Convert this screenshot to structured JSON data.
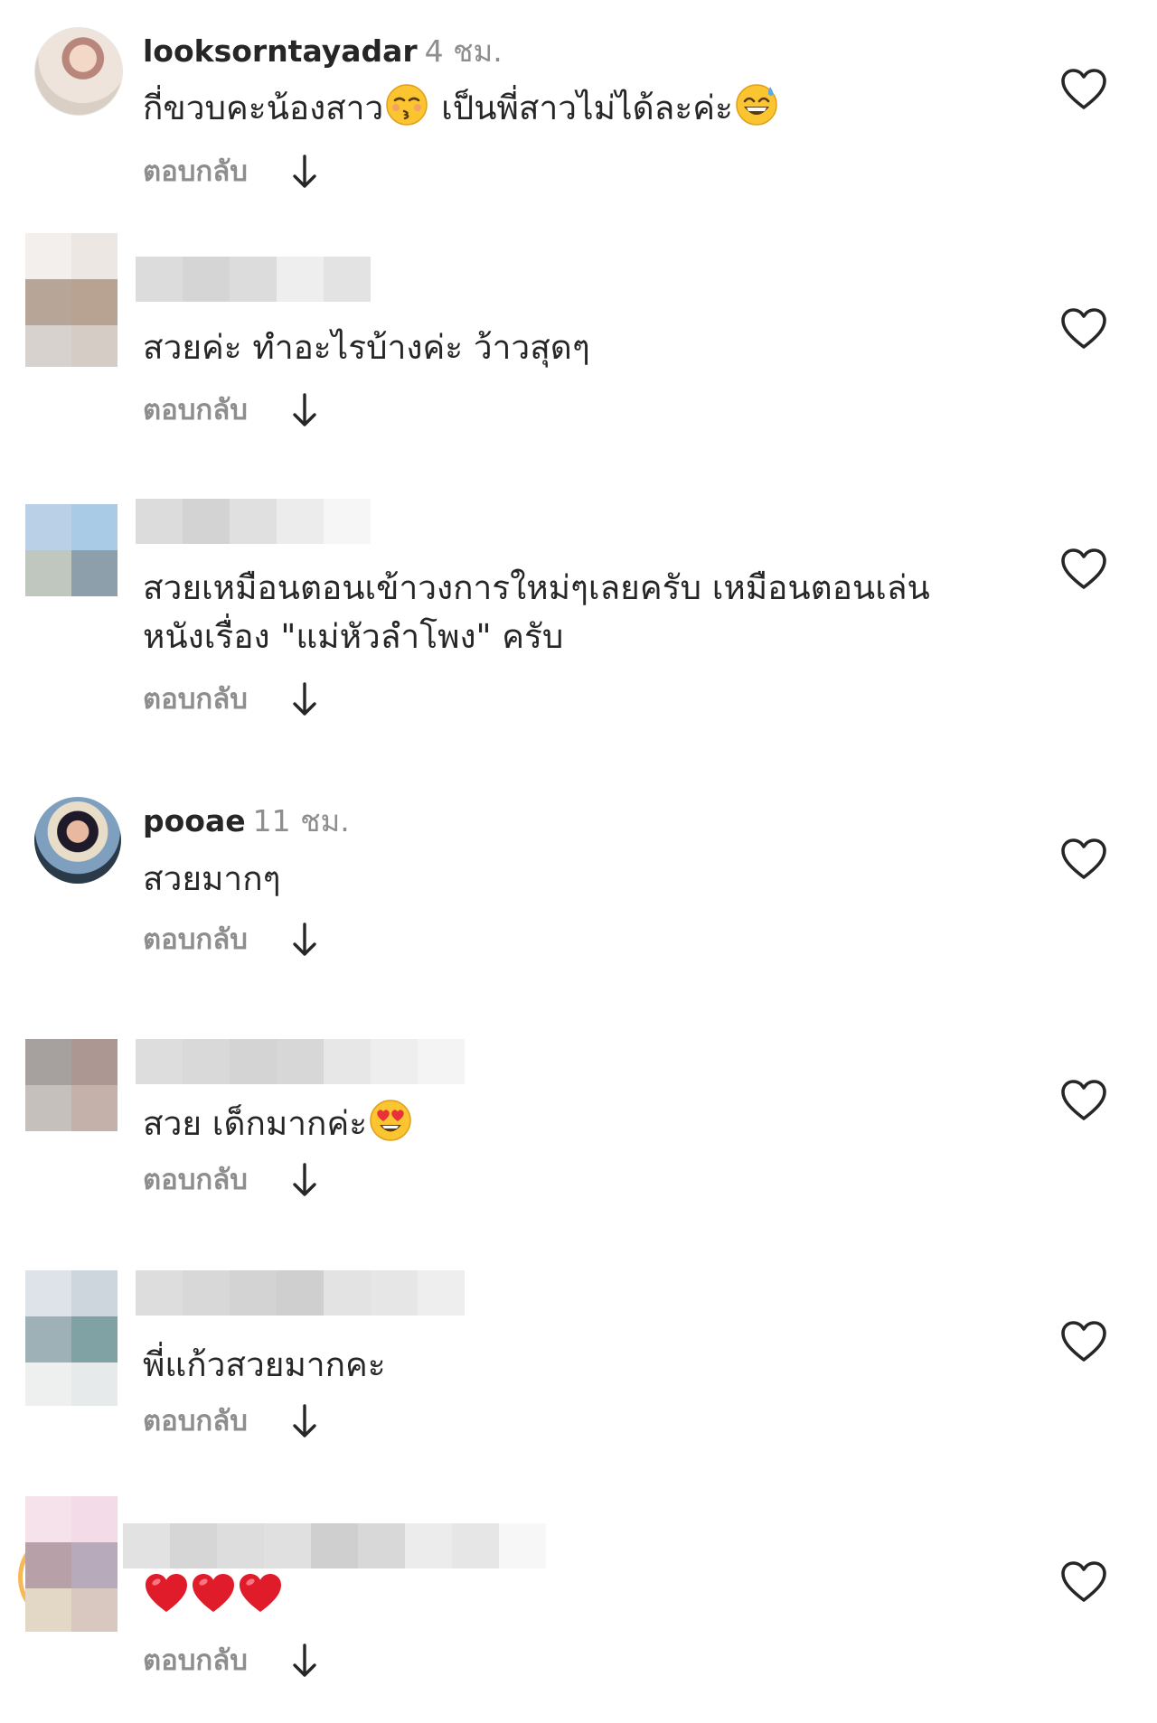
{
  "comments": [
    {
      "username": "looksorntayadar",
      "time": "4 ชม.",
      "text_before": "กี่ขวบคะน้องสาว",
      "emoji_1": "kissing-closed-eyes-emoji",
      "text_middle": "เป็นพี่สาวไม่ได้ละค่ะ",
      "emoji_2": "grinning-sweat-emoji",
      "reply_label": "ตอบกลับ"
    },
    {
      "text": "สวยค่ะ ทำอะไรบ้างค่ะ ว้าวสุดๆ",
      "reply_label": "ตอบกลับ"
    },
    {
      "text_line1": "สวยเหมือนตอนเข้าวงการใหม่ๆเลยครับ เหมือนตอนเล่น",
      "text_line2": "หนังเรื่อง \"แม่หัวลำโพง\" ครับ",
      "reply_label": "ตอบกลับ"
    },
    {
      "username": "pooae",
      "time": "11 ชม.",
      "text": "สวยมากๆ",
      "reply_label": "ตอบกลับ"
    },
    {
      "text": "สวย เด็กมากค่ะ",
      "emoji": "heart-eyes-emoji",
      "reply_label": "ตอบกลับ"
    },
    {
      "text": "พี่แก้วสวยมากคะ",
      "reply_label": "ตอบกลับ"
    },
    {
      "text": "",
      "emoji": "red-heart-emoji",
      "emoji_count": 3,
      "reply_label": "ตอบกลับ"
    }
  ],
  "colors": {
    "text": "#262626",
    "secondary": "#8e8e8e",
    "story_ring": "#f7b955"
  }
}
